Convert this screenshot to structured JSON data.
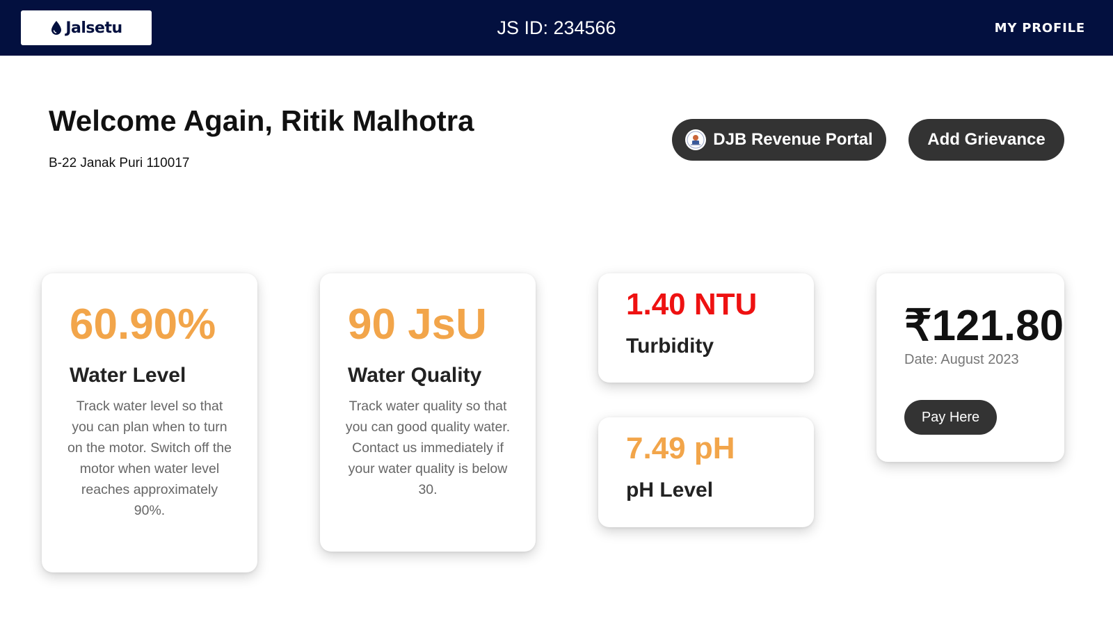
{
  "header": {
    "logo_text": "Jalsetu",
    "js_id": "JS ID: 234566",
    "profile_label": "MY PROFILE",
    "background_color": "#03103f"
  },
  "welcome": {
    "title": "Welcome Again, Ritik Malhotra",
    "address": "B-22 Janak Puri 110017"
  },
  "actions": {
    "djb_label": "DJB Revenue Portal",
    "grievance_label": "Add Grievance"
  },
  "cards": {
    "water_level": {
      "value": "60.90%",
      "title": "Water Level",
      "description": "Track water level so that you can plan when to turn on the motor. Switch off the motor when water level reaches approximately 90%."
    },
    "water_quality": {
      "value": "90 JsU",
      "title": "Water Quality",
      "description": "Track water quality so that you can good quality water. Contact us immediately if your water quality is below 30."
    },
    "turbidity": {
      "value": "1.40 NTU",
      "title": "Turbidity",
      "value_color": "#ee1111"
    },
    "ph": {
      "value": "7.49 pH",
      "title": "pH Level",
      "value_color": "#f2a54a"
    },
    "bill": {
      "amount": "₹121.80",
      "date": "Date: August 2023",
      "pay_label": "Pay Here"
    }
  },
  "colors": {
    "accent_orange": "#f2a54a",
    "alert_red": "#ee1111",
    "button_dark": "#333333"
  },
  "icons": {
    "logo": "water-drop-icon",
    "djb": "djb-emblem-icon"
  }
}
